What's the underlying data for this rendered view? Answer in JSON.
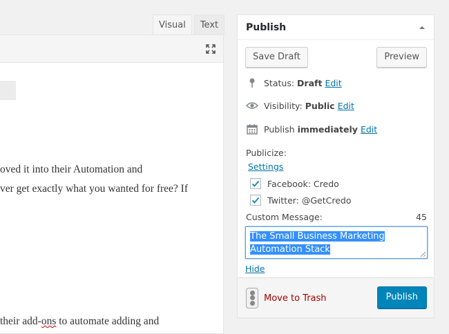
{
  "editor": {
    "tabs": [
      {
        "label": "Visual",
        "active": true
      },
      {
        "label": "Text",
        "active": false
      }
    ],
    "fullscreen_icon": "fullscreen-icon",
    "lines": [
      "oved it into their Automation and",
      "ver get exactly what you wanted for free? If",
      " their add-",
      "ons",
      " to automate adding and"
    ]
  },
  "publish": {
    "title": "Publish",
    "toggle_icon": "arrow-up-icon",
    "save_draft": "Save Draft",
    "preview": "Preview",
    "status": {
      "label": "Status:",
      "value": "Draft",
      "edit": "Edit",
      "icon": "pin-icon"
    },
    "visibility": {
      "label": "Visibility:",
      "value": "Public",
      "edit": "Edit",
      "icon": "eye-icon"
    },
    "schedule": {
      "label": "Publish",
      "value": "immediately",
      "edit": "Edit",
      "icon": "calendar-icon"
    },
    "publicize": {
      "label": "Publicize:",
      "settings": "Settings",
      "accounts": [
        {
          "label": "Facebook: Credo",
          "checked": true
        },
        {
          "label": "Twitter: @GetCredo",
          "checked": true
        }
      ],
      "custom_message_label": "Custom Message:",
      "char_count": "45",
      "message_line1": "The Small Business Marketing ",
      "message_line2": "Automation Stack",
      "hide": "Hide"
    },
    "move_to_trash": "Move to Trash",
    "publish_button": "Publish",
    "colors": {
      "primary": "#0085ba",
      "link": "#0073aa",
      "trash": "#a00"
    }
  }
}
